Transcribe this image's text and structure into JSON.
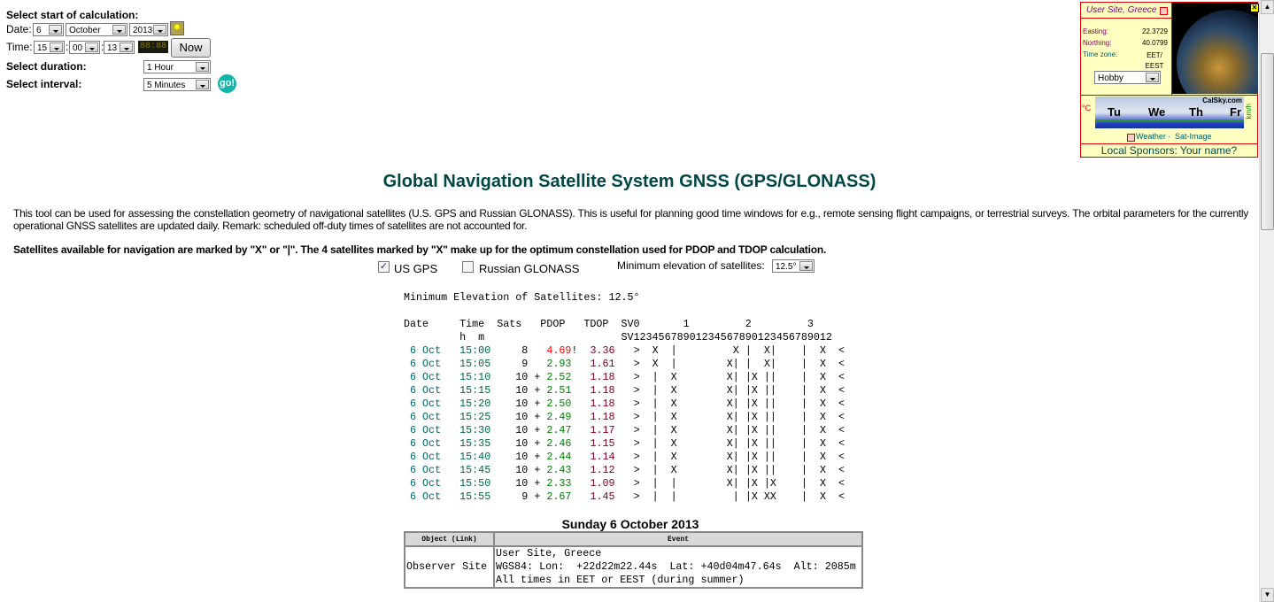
{
  "form": {
    "start_label": "Select start of calculation:",
    "date_label": "Date:",
    "date_day": "6",
    "date_month": "October",
    "date_year": "2013",
    "time_label": "Time:",
    "time_h": "15",
    "time_m": "00",
    "time_s": "13",
    "sep": ":",
    "clock": "88:88",
    "now_label": "Now",
    "duration_label": "Select duration:",
    "duration_value": "1 Hour",
    "interval_label": "Select interval:",
    "interval_value": "5 Minutes",
    "go_label": "go!"
  },
  "widget": {
    "site": "User Site, Greece",
    "easting_label": "Easting:",
    "easting": "22.3729",
    "northing_label": "Northing:",
    "northing": "40.0799",
    "tz_label": "Time zone:",
    "tz": "EET/ EEST",
    "mode": "Hobby",
    "weather_link": "Weather",
    "satimage_link": "Sat-Image",
    "dot": "·",
    "meteo_brand": "CalSky.com",
    "meteo_days": [
      "Tu",
      "We",
      "Th",
      "Fr"
    ],
    "temp_unit": "°C",
    "wind_unit": "km/h",
    "sponsors": "Local Sponsors: Your name?"
  },
  "title": "Global Navigation Satellite System GNSS (GPS/GLONASS)",
  "intro": "This tool can be used for assessing the constellation geometry of navigational satellites (U.S. GPS and Russian GLONASS). This is useful for planning good time windows for e.g., remote sensing flight campaigns, or terrestrial surveys. The orbital parameters for the currently operational GNSS satellites are updated daily. Remark: scheduled off-duty times of satellites are not accounted for.",
  "avail": "Satellites available for navigation are marked by \"X\" or \"|\". The 4 satellites marked by \"X\" make up for the optimum constellation used for PDOP and TDOP calculation.",
  "options": {
    "gps_label": "US GPS",
    "gps_checked": true,
    "glonass_label": "Russian GLONASS",
    "glonass_checked": false,
    "minelev_label": "Minimum elevation of satellites:",
    "minelev_value": "12.5°"
  },
  "results": {
    "min_elev_line": "Minimum Elevation of Satellites: 12.5°",
    "header1": "Date     Time  Sats   PDOP   TDOP  SV0       1         2         3",
    "header2": "         h  m                      SV12345678901234567890123456789012",
    "rows": [
      {
        "date": "6 Oct",
        "time": "15:00",
        "sats": "8",
        "plus": "",
        "pdop": "4.69",
        "flag": "!",
        "tdop": "3.36",
        "sv": ">  X  |         X |  X|    |  X  <"
      },
      {
        "date": "6 Oct",
        "time": "15:05",
        "sats": "9",
        "plus": "",
        "pdop": "2.93",
        "flag": "",
        "tdop": "1.61",
        "sv": ">  X  |        X| |  X|    |  X  <"
      },
      {
        "date": "6 Oct",
        "time": "15:10",
        "sats": "10",
        "plus": "+",
        "pdop": "2.52",
        "flag": "",
        "tdop": "1.18",
        "sv": ">  |  X        X| |X ||    |  X  <"
      },
      {
        "date": "6 Oct",
        "time": "15:15",
        "sats": "10",
        "plus": "+",
        "pdop": "2.51",
        "flag": "",
        "tdop": "1.18",
        "sv": ">  |  X        X| |X ||    |  X  <"
      },
      {
        "date": "6 Oct",
        "time": "15:20",
        "sats": "10",
        "plus": "+",
        "pdop": "2.50",
        "flag": "",
        "tdop": "1.18",
        "sv": ">  |  X        X| |X ||    |  X  <"
      },
      {
        "date": "6 Oct",
        "time": "15:25",
        "sats": "10",
        "plus": "+",
        "pdop": "2.49",
        "flag": "",
        "tdop": "1.18",
        "sv": ">  |  X        X| |X ||    |  X  <"
      },
      {
        "date": "6 Oct",
        "time": "15:30",
        "sats": "10",
        "plus": "+",
        "pdop": "2.47",
        "flag": "",
        "tdop": "1.17",
        "sv": ">  |  X        X| |X ||    |  X  <"
      },
      {
        "date": "6 Oct",
        "time": "15:35",
        "sats": "10",
        "plus": "+",
        "pdop": "2.46",
        "flag": "",
        "tdop": "1.15",
        "sv": ">  |  X        X| |X ||    |  X  <"
      },
      {
        "date": "6 Oct",
        "time": "15:40",
        "sats": "10",
        "plus": "+",
        "pdop": "2.44",
        "flag": "",
        "tdop": "1.14",
        "sv": ">  |  X        X| |X ||    |  X  <"
      },
      {
        "date": "6 Oct",
        "time": "15:45",
        "sats": "10",
        "plus": "+",
        "pdop": "2.43",
        "flag": "",
        "tdop": "1.12",
        "sv": ">  |  X        X| |X ||    |  X  <"
      },
      {
        "date": "6 Oct",
        "time": "15:50",
        "sats": "10",
        "plus": "+",
        "pdop": "2.33",
        "flag": "",
        "tdop": "1.09",
        "sv": ">  |  |        X| |X |X    |  X  <"
      },
      {
        "date": "6 Oct",
        "time": "15:55",
        "sats": "9",
        "plus": "+",
        "pdop": "2.67",
        "flag": "",
        "tdop": "1.45",
        "sv": ">  |  |         | |X XX    |  X  <"
      }
    ]
  },
  "events": {
    "heading": "Sunday 6 October 2013",
    "col_object": "Object (Link)",
    "col_event": "Event",
    "object": "Observer Site",
    "lines": [
      "User Site, Greece",
      "WGS84: Lon:  +22d22m22.44s  Lat: +40d04m47.64s  Alt: 2085m",
      "All times in EET or EEST (during summer)"
    ]
  },
  "colors": {
    "title": "#004848",
    "pdop_good": "#008000",
    "pdop_bad": "#ff0000",
    "widget_border": "#dd0000",
    "widget_bg": "#ffffc0",
    "go": "#16b3a8"
  }
}
